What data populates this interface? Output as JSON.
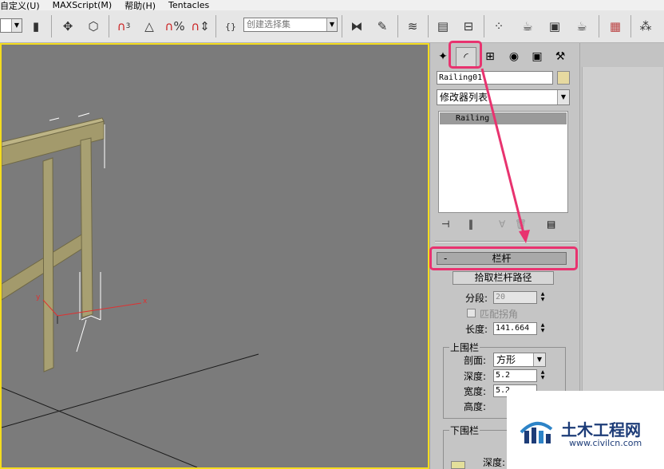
{
  "menu": {
    "items": [
      "自定义(U)",
      "MAXScript(M)",
      "帮助(H)",
      "Tentacles"
    ]
  },
  "toolbar": {
    "snap_label": "3",
    "named_selection_placeholder": "创建选择集",
    "icons": [
      "select-filter-icon",
      "select-move-icon",
      "transform-icon",
      "snap-3d-icon",
      "angle-snap-icon",
      "percent-snap-icon",
      "spinner-snap-icon",
      "edit-named-sets-icon",
      "mirror-icon",
      "align-icon",
      "layer-manager-icon",
      "curve-editor-icon",
      "schematic-view-icon",
      "material-editor-icon",
      "render-setup-icon",
      "render-frame-icon",
      "quick-render-icon",
      "pivot-icon",
      "assembly-icon"
    ]
  },
  "viewport": {
    "border_color": "#f4dc1e",
    "background": "#7b7b7b",
    "gizmo_x_label": "x",
    "gizmo_y_label": "y"
  },
  "command_panel": {
    "tabs": [
      "create-tab-icon",
      "modify-tab-icon",
      "hierarchy-tab-icon",
      "motion-tab-icon",
      "display-tab-icon",
      "utilities-tab-icon"
    ],
    "object_name": "Railing01",
    "object_color": "#e6d9a0",
    "modifier_list": "修改器列表",
    "stack_items": [
      "Railing"
    ],
    "rollout": {
      "minus": "-",
      "title": "栏杆",
      "pick_button": "拾取栏杆路径",
      "segments_label": "分段:",
      "segments_value": "20",
      "match_corners_label": "匹配拐角",
      "length_label": "长度:",
      "length_value": "141.664",
      "top_rail": {
        "title": "上围栏",
        "profile_label": "剖面:",
        "profile_value": "方形",
        "depth_label": "深度:",
        "depth_value": "5.2",
        "width_label": "宽度:",
        "width_value": "5.2",
        "height_label": "高度:"
      },
      "lower_rail": {
        "title": "下围栏",
        "depth_label": "深度:"
      }
    }
  },
  "annotation": {
    "color": "#e8336f"
  },
  "watermark": {
    "title": "土木工程网",
    "url": "www.civilcn.com"
  }
}
